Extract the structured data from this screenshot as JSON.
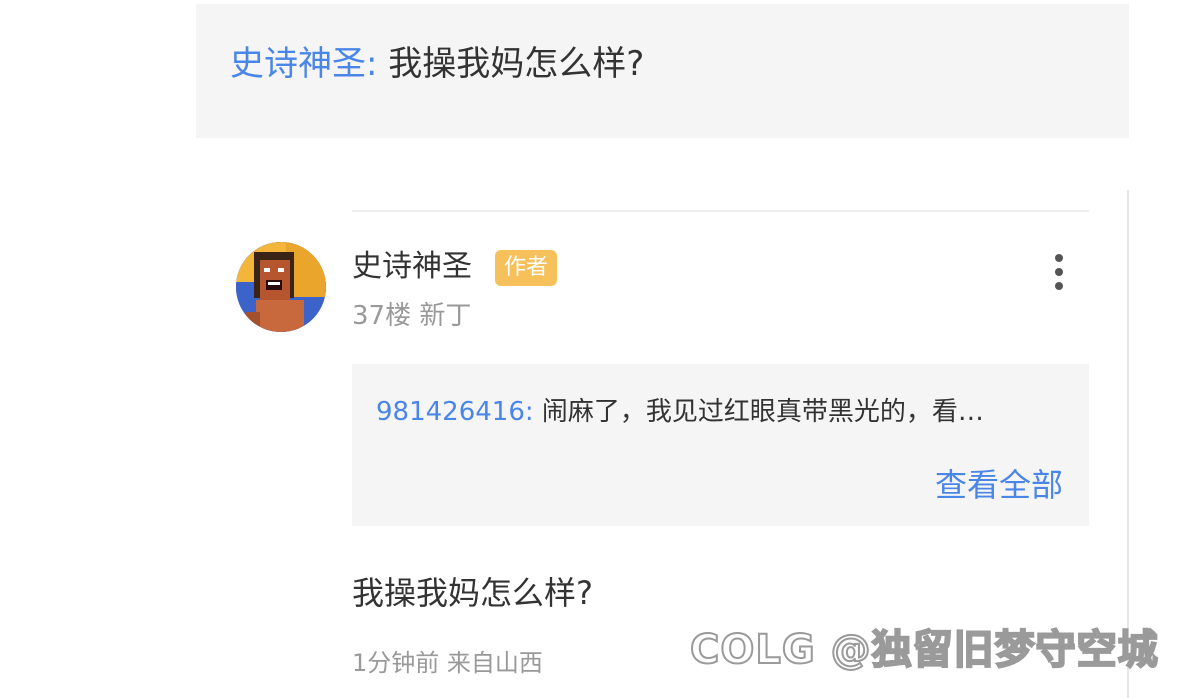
{
  "quote_top": {
    "name": "史诗神圣:",
    "text": "我操我妈怎么样?"
  },
  "post": {
    "author": "史诗神圣",
    "badge": "作者",
    "floor_and_level": "37楼 新丁",
    "more_icon": "more-vertical-icon",
    "sub_reply": {
      "name": "981426416:",
      "text": "闹麻了，我见过红眼真带黑光的，看…",
      "view_all": "查看全部"
    },
    "content": "我操我妈怎么样?",
    "time_location": "1分钟前 来自山西"
  },
  "watermark": "COLG @独留旧梦守空城",
  "colors": {
    "link_blue": "#4a86e8",
    "badge_orange": "#f6c05a",
    "card_bg": "#f5f5f5",
    "meta_gray": "#999999"
  }
}
